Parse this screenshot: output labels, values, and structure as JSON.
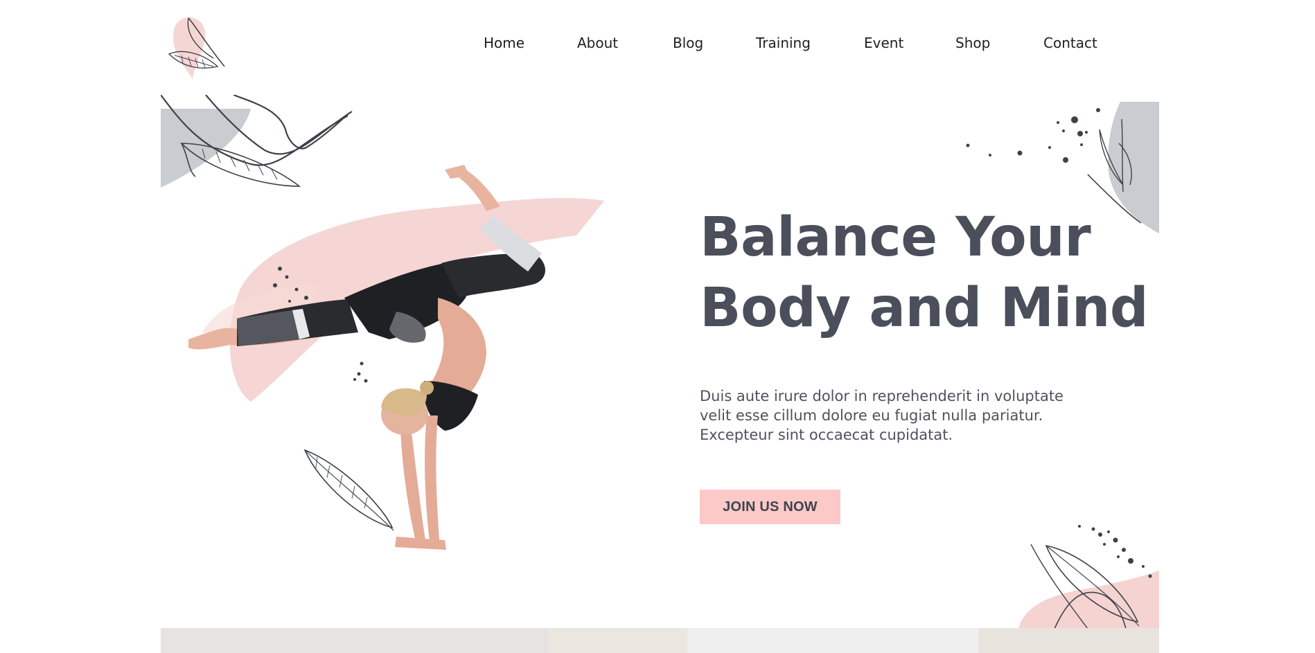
{
  "nav": {
    "items": [
      {
        "label": "Home"
      },
      {
        "label": "About"
      },
      {
        "label": "Blog"
      },
      {
        "label": "Training"
      },
      {
        "label": "Event"
      },
      {
        "label": "Shop"
      },
      {
        "label": "Contact"
      }
    ]
  },
  "hero": {
    "headline_line1": "Balance Your",
    "headline_line2": "Body and Mind",
    "description": "Duis aute irure dolor in reprehenderit in voluptate velit esse cillum dolore eu fugiat nulla pariatur. Excepteur sint occaecat cupidatat.",
    "cta_label": "JOIN US NOW"
  },
  "colors": {
    "accent_pink": "#fbc9c8",
    "heading": "#4a4f5b",
    "deco_gray": "#c9ccd0",
    "line_dark": "#3e4149"
  }
}
